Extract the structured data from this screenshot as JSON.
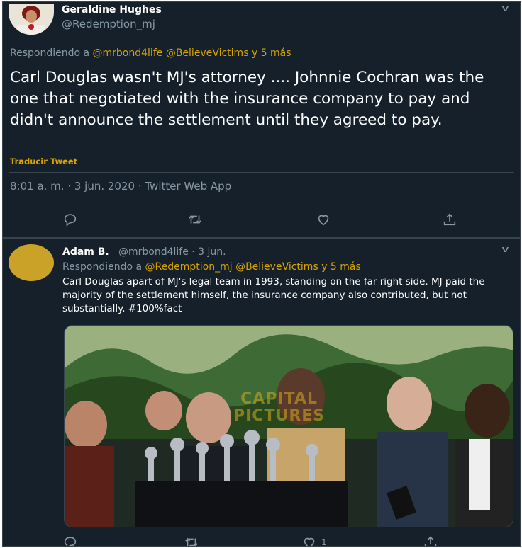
{
  "tweet_main": {
    "author_name": "Geraldine Hughes",
    "author_handle": "@Redemption_mj",
    "reply_prefix": "Respondiendo a",
    "reply_mentions": "@mrbond4life @BelieveVictims y 5 más",
    "text": "Carl Douglas wasn't MJ's attorney .... Johnnie Cochran was the one that negotiated with the insurance company to pay and didn't announce the settlement until they agreed to pay.",
    "translate_label": "Traducir Tweet",
    "timestamp": "8:01 a. m. · 3 jun. 2020 · Twitter Web App"
  },
  "tweet_reply": {
    "author_name": "Adam B.",
    "author_handle_date": "@mrbond4life · 3 jun.",
    "reply_prefix": "Respondiendo a",
    "reply_mentions": "@Redemption_mj @BelieveVictims y 5 más",
    "text": "Carl Douglas apart of MJ's legal team in 1993, standing on the far right side. MJ paid the majority of the settlement himself, the insurance company also contributed, but not substantially. #100%fact",
    "photo_watermark_line1": "CAPITAL",
    "photo_watermark_line2": "PICTURES",
    "like_count": "1"
  },
  "colors": {
    "background": "#15202b",
    "divider": "#38444d",
    "secondary_text": "#8899a6",
    "accent": "#d6a300"
  },
  "icons": [
    "chevron-down-icon",
    "reply-icon",
    "retweet-icon",
    "like-icon",
    "share-icon"
  ]
}
